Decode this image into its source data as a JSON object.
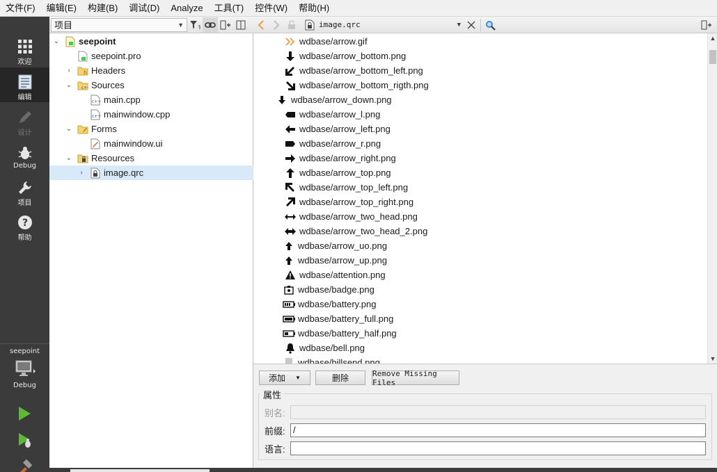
{
  "menu": [
    "文件(F)",
    "编辑(E)",
    "构建(B)",
    "调试(D)",
    "Analyze",
    "工具(T)",
    "控件(W)",
    "帮助(H)"
  ],
  "modes": [
    {
      "label": "欢迎",
      "icon": "grid-icon"
    },
    {
      "label": "编辑",
      "icon": "edit-document-icon"
    },
    {
      "label": "设计",
      "icon": "pencil-icon"
    },
    {
      "label": "Debug",
      "icon": "bug-icon"
    },
    {
      "label": "项目",
      "icon": "wrench-icon"
    },
    {
      "label": "帮助",
      "icon": "help-icon"
    }
  ],
  "active_mode": "编辑",
  "kit": {
    "project": "seepoint",
    "target": "Debug"
  },
  "project_pane": {
    "combo": "项目"
  },
  "tree": [
    {
      "label": "seepoint",
      "level": 0,
      "expanded": true,
      "icon": "project-icon",
      "bold": true
    },
    {
      "label": "seepoint.pro",
      "level": 1,
      "icon": "pro-file-icon"
    },
    {
      "label": "Headers",
      "level": 1,
      "expanded": false,
      "icon": "headers-folder-icon"
    },
    {
      "label": "Sources",
      "level": 1,
      "expanded": true,
      "icon": "sources-folder-icon"
    },
    {
      "label": "main.cpp",
      "level": 2,
      "icon": "cpp-file-icon"
    },
    {
      "label": "mainwindow.cpp",
      "level": 2,
      "icon": "cpp-file-icon"
    },
    {
      "label": "Forms",
      "level": 1,
      "expanded": true,
      "icon": "forms-folder-icon"
    },
    {
      "label": "mainwindow.ui",
      "level": 2,
      "icon": "ui-file-icon"
    },
    {
      "label": "Resources",
      "level": 1,
      "expanded": true,
      "icon": "resources-folder-icon"
    },
    {
      "label": "image.qrc",
      "level": 2,
      "expanded": false,
      "icon": "qrc-file-icon",
      "selected": true
    }
  ],
  "editor": {
    "document": "image.qrc"
  },
  "resources": [
    {
      "label": "wdbase/arrow.gif",
      "icon": "double-chevron-icon"
    },
    {
      "label": "wdbase/arrow_bottom.png",
      "icon": "arrow-down-icon"
    },
    {
      "label": "wdbase/arrow_bottom_left.png",
      "icon": "arrow-down-left-icon"
    },
    {
      "label": "wdbase/arrow_bottom_rigth.png",
      "icon": "arrow-down-right-icon"
    },
    {
      "label": "wdbase/arrow_down.png",
      "icon": "small-arrow-down-icon"
    },
    {
      "label": "wdbase/arrow_l.png",
      "icon": "tag-left-icon"
    },
    {
      "label": "wdbase/arrow_left.png",
      "icon": "arrow-left-icon"
    },
    {
      "label": "wdbase/arrow_r.png",
      "icon": "tag-right-icon"
    },
    {
      "label": "wdbase/arrow_right.png",
      "icon": "arrow-right-icon"
    },
    {
      "label": "wdbase/arrow_top.png",
      "icon": "arrow-up-icon"
    },
    {
      "label": "wdbase/arrow_top_left.png",
      "icon": "arrow-up-left-icon"
    },
    {
      "label": "wdbase/arrow_top_right.png",
      "icon": "arrow-up-right-icon"
    },
    {
      "label": "wdbase/arrow_two_head.png",
      "icon": "two-head-arrow-icon"
    },
    {
      "label": "wdbase/arrow_two_head_2.png",
      "icon": "two-head-arrow-bold-icon"
    },
    {
      "label": "wdbase/arrow_uo.png",
      "icon": "small-arrow-up-icon"
    },
    {
      "label": "wdbase/arrow_up.png",
      "icon": "small-arrow-up-icon"
    },
    {
      "label": "wdbase/attention.png",
      "icon": "warning-icon"
    },
    {
      "label": "wdbase/badge.png",
      "icon": "badge-icon"
    },
    {
      "label": "wdbase/battery.png",
      "icon": "battery-icon"
    },
    {
      "label": "wdbase/battery_full.png",
      "icon": "battery-full-icon"
    },
    {
      "label": "wdbase/battery_half.png",
      "icon": "battery-half-icon"
    },
    {
      "label": "wdbase/bell.png",
      "icon": "bell-icon"
    },
    {
      "label": "wdbase/billsend.png",
      "icon": "document-icon"
    }
  ],
  "buttons": {
    "add": "添加",
    "remove": "删除",
    "remove_missing": "Remove Missing Files"
  },
  "properties": {
    "title": "属性",
    "alias_label": "别名:",
    "alias_value": "",
    "prefix_label": "前缀:",
    "prefix_value": "/",
    "lang_label": "语言:",
    "lang_value": ""
  },
  "colors": {
    "modebar": "#3b3b3b",
    "selection": "#d8eaf9",
    "run_green": "#5fb832",
    "nav_orange": "#e8a23a"
  }
}
